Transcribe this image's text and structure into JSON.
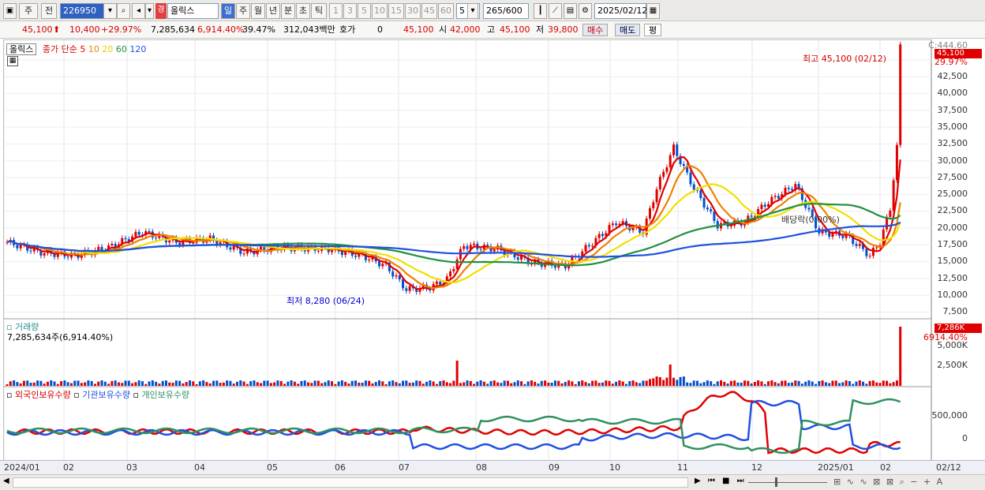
{
  "toolbar": {
    "period_mode": "주",
    "prev_label": "전",
    "code": "226950",
    "name": "올릭스",
    "periods": [
      "일",
      "주",
      "월",
      "년",
      "분",
      "초",
      "틱"
    ],
    "intervals": [
      "1",
      "3",
      "5",
      "10",
      "15",
      "30",
      "45",
      "60"
    ],
    "count_select": "5",
    "range": "265/600",
    "date": "2025/02/12"
  },
  "quote": {
    "price": "45,100",
    "change": "10,400",
    "change_pct": "+29.97%",
    "volume": "7,285,634",
    "volume_ratio": "6,914.40%",
    "turnover": "39.47%",
    "value": "312,043백만",
    "hoga_label": "호가",
    "hoga": "0",
    "bid": "45,100",
    "open_label": "시",
    "open": "42,000",
    "high_label": "고",
    "high": "45,100",
    "low_label": "저",
    "low": "39,800",
    "buy": "매수",
    "sell": "매도",
    "eval": "평"
  },
  "legend": {
    "name": "올릭스",
    "ma_label": "종가 단순",
    "ma": [
      {
        "p": "5",
        "c": "#e00000"
      },
      {
        "p": "10",
        "c": "#f08000"
      },
      {
        "p": "20",
        "c": "#f0e000"
      },
      {
        "p": "60",
        "c": "#209040"
      },
      {
        "p": "120",
        "c": "#2050e0"
      }
    ]
  },
  "annotations": {
    "high": "최고 45,100 (02/12)",
    "low": "최저 8,280 (06/24)",
    "div": "배당락(0.00%)"
  },
  "yaxis": {
    "top": "C:444.60",
    "price_tag": "45,100",
    "pct_tag": "29.97%",
    "ticks": [
      "42,500",
      "40,000",
      "37,500",
      "35,000",
      "32,500",
      "30,000",
      "27,500",
      "25,000",
      "22,500",
      "20,000",
      "17,500",
      "15,000",
      "12,500",
      "10,000",
      "7,500"
    ]
  },
  "volume_panel": {
    "title": "거래량",
    "value": "7,285,634주(6,914.40%)",
    "tag": "7,286K",
    "pct": "6914.40%",
    "ticks": [
      "5,000K",
      "2,500K"
    ]
  },
  "holding_panel": {
    "s1": "외국인보유수량",
    "s2": "기관보유수량",
    "s3": "개인보유수량",
    "ticks": [
      "500,000",
      "0"
    ]
  },
  "xaxis": [
    "2024/01",
    "02",
    "03",
    "04",
    "05",
    "06",
    "07",
    "08",
    "09",
    "10",
    "11",
    "12",
    "2025/01",
    "02"
  ],
  "xaxis_right": "02/12",
  "colors": {
    "up": "#e00000",
    "down": "#0050d0",
    "foreign": "#e00000",
    "inst": "#2050e0",
    "indiv": "#309060"
  }
}
